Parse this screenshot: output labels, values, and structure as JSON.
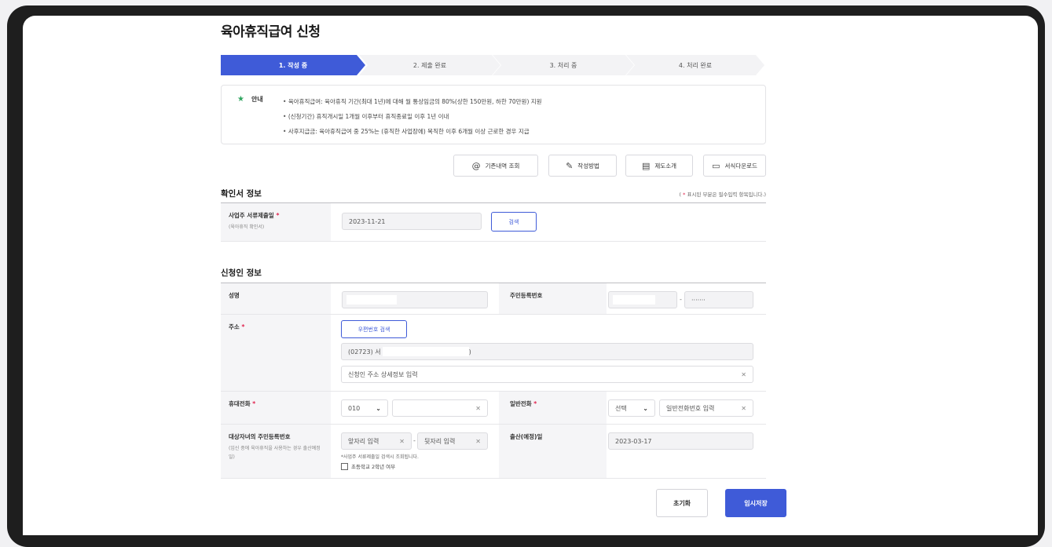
{
  "page_title": "육아휴직급여 신청",
  "steps": [
    "1. 작성 중",
    "2. 제출 완료",
    "3. 처리 중",
    "4. 처리 완료"
  ],
  "notice": {
    "label": "안내",
    "lines": [
      "육아휴직급여: 육아휴직 기간(최대 1년)에 대해 월 통상임금의 80%(상한 150만원, 하한 70만원) 지원",
      "(신청기간) 휴직개시일 1개월 이후부터 휴직종료일 이후 1년 이내",
      "사후지급금: 육아휴직급여 중 25%는 (휴직한 사업장에) 복직한 이후 6개월 이상 근로한 경우 지급"
    ]
  },
  "toolbar": {
    "history": "기존내역 조회",
    "howto": "작성방법",
    "intro": "제도소개",
    "download": "서식다운로드"
  },
  "confirm_section": {
    "title": "확인서 정보",
    "required_note": "표시된 부분은 필수입력 항목입니다.",
    "submit_date_label": "사업주 서류제출일",
    "submit_date_sub": "(육아휴직 확인서)",
    "submit_date_value": "2023-11-21",
    "search_button": "검색"
  },
  "applicant_section": {
    "title": "신청인 정보",
    "name_label": "성명",
    "rrn_label": "주민등록번호",
    "rrn_back": "·······",
    "address_label": "주소",
    "zip_search_button": "우편번호 검색",
    "address_value": "(02723) 서",
    "address_tail": ")",
    "address_detail_placeholder": "신청인 주소 상세정보 입력",
    "mobile_label": "휴대전화",
    "mobile_prefix": "010",
    "phone_label": "일반전화",
    "phone_select": "선택",
    "phone_placeholder": "일반전화번호 입력",
    "child_rrn_label": "대상자녀의 주민등록번호",
    "child_rrn_sub": "(임신 중에 육아휴직을 사용하는 경우 출산예정일)",
    "child_front_placeholder": "앞자리 입력",
    "child_back_placeholder": "뒷자리 입력",
    "child_note": "*사업주 서류제출일 검색시 조회됩니다.",
    "grade2_checkbox": "초등학교 2학년 여부",
    "birth_label": "출산(예정)일",
    "birth_value": "2023-03-17"
  },
  "actions": {
    "reset": "초기화",
    "temp_save": "임시저장"
  },
  "colors": {
    "primary": "#3f5bd8",
    "required": "#e0234e",
    "notice_icon": "#2fa55f"
  }
}
